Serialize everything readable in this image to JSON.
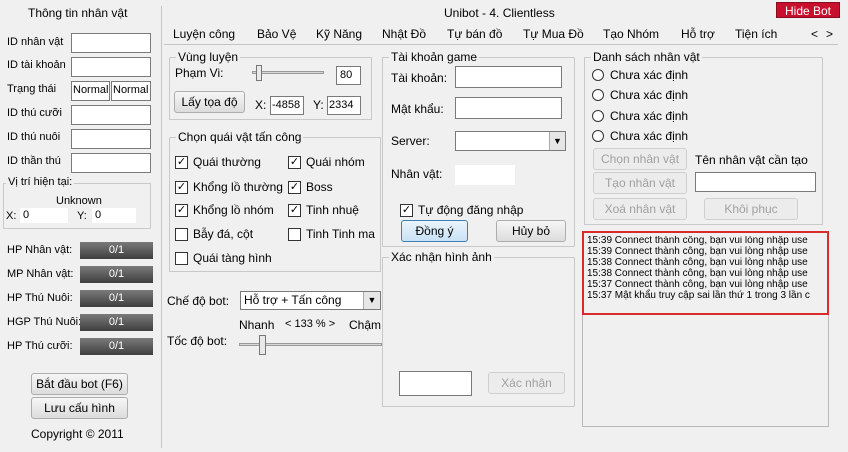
{
  "window": {
    "title": "Unibot - 4. Clientless",
    "hide_button": "Hide Bot"
  },
  "left": {
    "title": "Thông tin nhân vật",
    "fields": [
      {
        "label": "ID nhân vật"
      },
      {
        "label": "ID tài khoản"
      },
      {
        "label": "Trạng thái",
        "value1": "Normal",
        "value2": "Normal"
      },
      {
        "label": "ID thú cưỡi"
      },
      {
        "label": "ID thú nuôi"
      },
      {
        "label": "ID thần thú"
      }
    ],
    "position": {
      "label": "Vị trí hiện tại:",
      "status": "Unknown",
      "x_label": "X:",
      "x_value": "0",
      "y_label": "Y:",
      "y_value": "0"
    },
    "bars": [
      {
        "label": "HP Nhân vật:",
        "value": "0/1"
      },
      {
        "label": "MP Nhân vật:",
        "value": "0/1"
      },
      {
        "label": "HP Thú Nuôi:",
        "value": "0/1"
      },
      {
        "label": "HGP Thú Nuôi:",
        "value": "0/1"
      },
      {
        "label": "HP Thú cưỡi:",
        "value": "0/1"
      }
    ],
    "start_button": "Bắt đầu bot (F6)",
    "save_button": "Lưu cấu hình",
    "copyright": "Copyright © 2011"
  },
  "tabs": [
    "Luyện công",
    "Bảo Vệ",
    "Kỹ Năng",
    "Nhật Đồ",
    "Tự bán đồ",
    "Tự Mua Đồ",
    "Tạo Nhóm",
    "Hỗ trợ",
    "Tiện ích"
  ],
  "nav": {
    "prev": "<",
    "next": ">"
  },
  "training": {
    "title": "Vùng luyện",
    "range_label": "Phạm Vi:",
    "range_value": "80",
    "get_coords": "Lấy tọa độ",
    "x_label": "X:",
    "x_value": "-4858",
    "y_label": "Y:",
    "y_value": "2334"
  },
  "monsters": {
    "title": "Chọn quái vật tấn công",
    "items": [
      {
        "label": "Quái thường",
        "checked": true
      },
      {
        "label": "Quái nhóm",
        "checked": true
      },
      {
        "label": "Khổng lồ thường",
        "checked": true
      },
      {
        "label": "Boss",
        "checked": true
      },
      {
        "label": "Khổng lồ nhóm",
        "checked": true
      },
      {
        "label": "Tinh nhuệ",
        "checked": true
      },
      {
        "label": "Bẫy đá, cột",
        "checked": false
      },
      {
        "label": "Tinh Tinh ma",
        "checked": false
      },
      {
        "label": "Quái tàng hình",
        "checked": false
      }
    ]
  },
  "bot_mode": {
    "label": "Chế độ bot:",
    "value": "Hỗ trợ + Tấn công"
  },
  "bot_speed": {
    "label": "Tốc độ bot:",
    "fast": "Nhanh",
    "percent": "< 133 % >",
    "slow": "Chậm",
    "level": 0.1
  },
  "account": {
    "title": "Tài khoản game",
    "username_label": "Tài khoản:",
    "password_label": "Mật khẩu:",
    "server_label": "Server:",
    "character_label": "Nhân vật:",
    "auto_login": "Tự động đăng nhập",
    "ok_button": "Đồng ý",
    "cancel_button": "Hủy bỏ"
  },
  "captcha": {
    "title": "Xác nhận hình ảnh",
    "confirm_button": "Xác nhận"
  },
  "characters": {
    "title": "Danh sách nhân vật",
    "options": [
      "Chưa xác định",
      "Chưa xác định",
      "Chưa xác định",
      "Chưa xác định"
    ],
    "select_button": "Chọn nhân vật",
    "create_button": "Tạo nhân vật",
    "delete_button": "Xoá nhân vật",
    "restore_button": "Khôi phục",
    "new_name_label": "Tên nhân vật cần tạo"
  },
  "log": [
    "15:39 Connect thành công, bạn vui lòng nhập use",
    "15:39 Connect thành công, bạn vui lòng nhập use",
    "15:38 Connect thành công, bạn vui lòng nhập use",
    "15:38 Connect thành công, bạn vui lòng nhập use",
    "15:37 Connect thành công, bạn vui lòng nhập use",
    "15:37 Mật khẩu truy cập sai lần thứ 1 trong 3 lần c"
  ],
  "colors": {
    "hide_bg": "#c8102e",
    "log_border": "#d92b2b",
    "bar_bg": "#4f4f4f"
  }
}
